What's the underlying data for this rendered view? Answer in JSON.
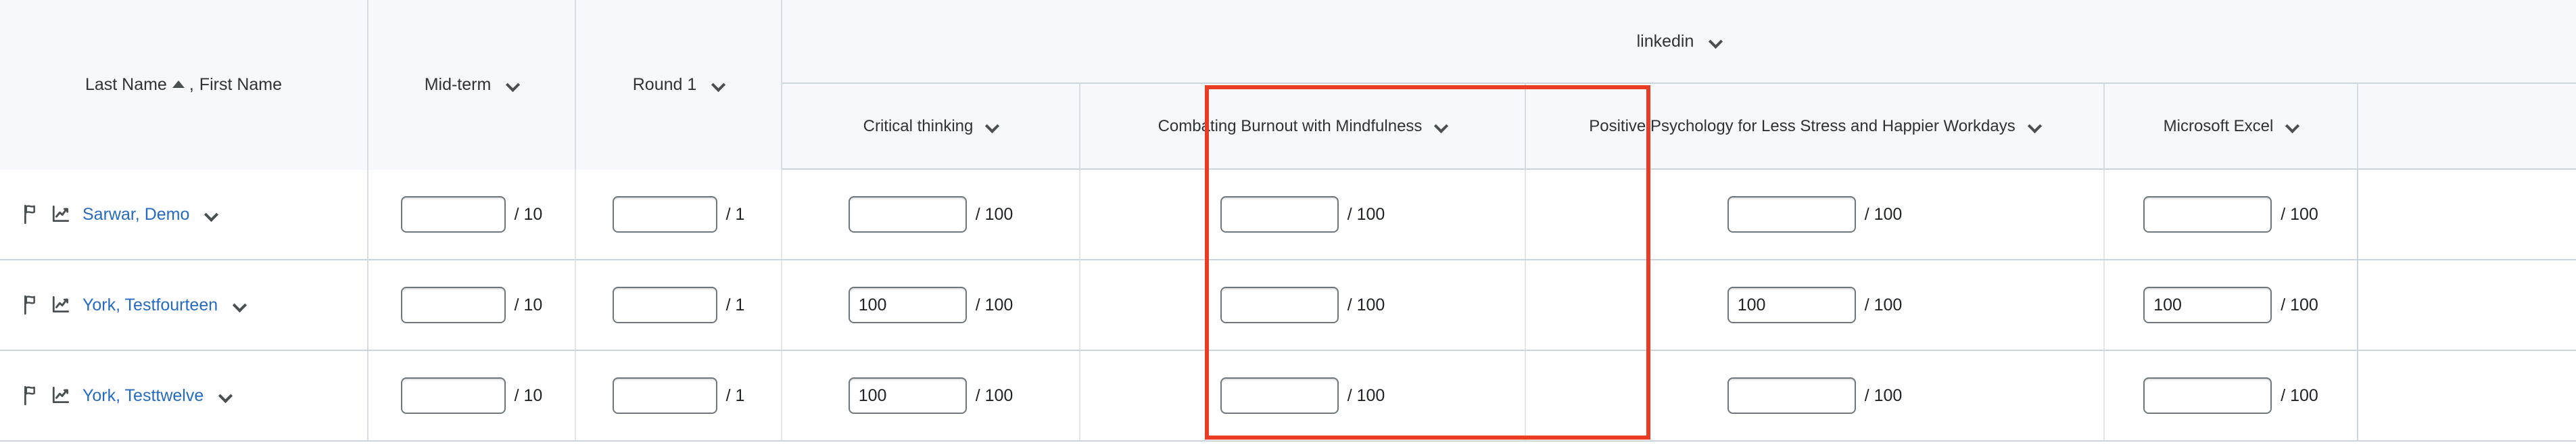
{
  "table": {
    "name_column": {
      "label_last": "Last Name",
      "sort_icon": "sort-ascending-triangle-icon",
      "label_separator": ",",
      "label_first": "First Name"
    },
    "static_columns": [
      {
        "label": "Mid-term",
        "denominator": "/ 10",
        "menu_icon": "chevron-down-icon"
      },
      {
        "label": "Round 1",
        "denominator": "/ 1",
        "menu_icon": "chevron-down-icon"
      }
    ],
    "group": {
      "label": "linkedin",
      "menu_icon": "chevron-down-icon",
      "columns": [
        {
          "label": "Critical thinking",
          "denominator": "/ 100",
          "menu_icon": "chevron-down-icon",
          "highlighted": false
        },
        {
          "label": "Combating Burnout with Mindfulness",
          "denominator": "/ 100",
          "menu_icon": "chevron-down-icon",
          "highlighted": true
        },
        {
          "label": "Positive Psychology for Less Stress and Happier Workdays",
          "denominator": "/ 100",
          "menu_icon": "chevron-down-icon",
          "highlighted": false
        },
        {
          "label": "Microsoft Excel",
          "denominator": "/ 100",
          "menu_icon": "chevron-down-icon",
          "highlighted": false
        }
      ]
    },
    "rows": [
      {
        "flag_icon": "flag-icon",
        "trend_icon": "trend-chart-icon",
        "student": "Sarwar, Demo",
        "menu_icon": "chevron-down-icon",
        "grades": {
          "midterm": "",
          "round1": "",
          "critical_thinking": "",
          "combating_burnout": "",
          "positive_psychology": "",
          "microsoft_excel": ""
        }
      },
      {
        "flag_icon": "flag-icon",
        "trend_icon": "trend-chart-icon",
        "student": "York, Testfourteen",
        "menu_icon": "chevron-down-icon",
        "grades": {
          "midterm": "",
          "round1": "",
          "critical_thinking": "100",
          "combating_burnout": "",
          "positive_psychology": "100",
          "microsoft_excel": "100"
        }
      },
      {
        "flag_icon": "flag-icon",
        "trend_icon": "trend-chart-icon",
        "student": "York, Testtwelve",
        "menu_icon": "chevron-down-icon",
        "grades": {
          "midterm": "",
          "round1": "",
          "critical_thinking": "100",
          "combating_burnout": "",
          "positive_psychology": "",
          "microsoft_excel": ""
        }
      }
    ],
    "denominators": {
      "midterm": "/ 10",
      "round1": "/ 1",
      "hundred": "/ 100"
    },
    "colors": {
      "header_background": "#F7F8FC",
      "link": "#276BC0",
      "highlight_border": "#EA3C24",
      "grid_line": "#CDD5DC",
      "text": "#2F3335"
    }
  }
}
